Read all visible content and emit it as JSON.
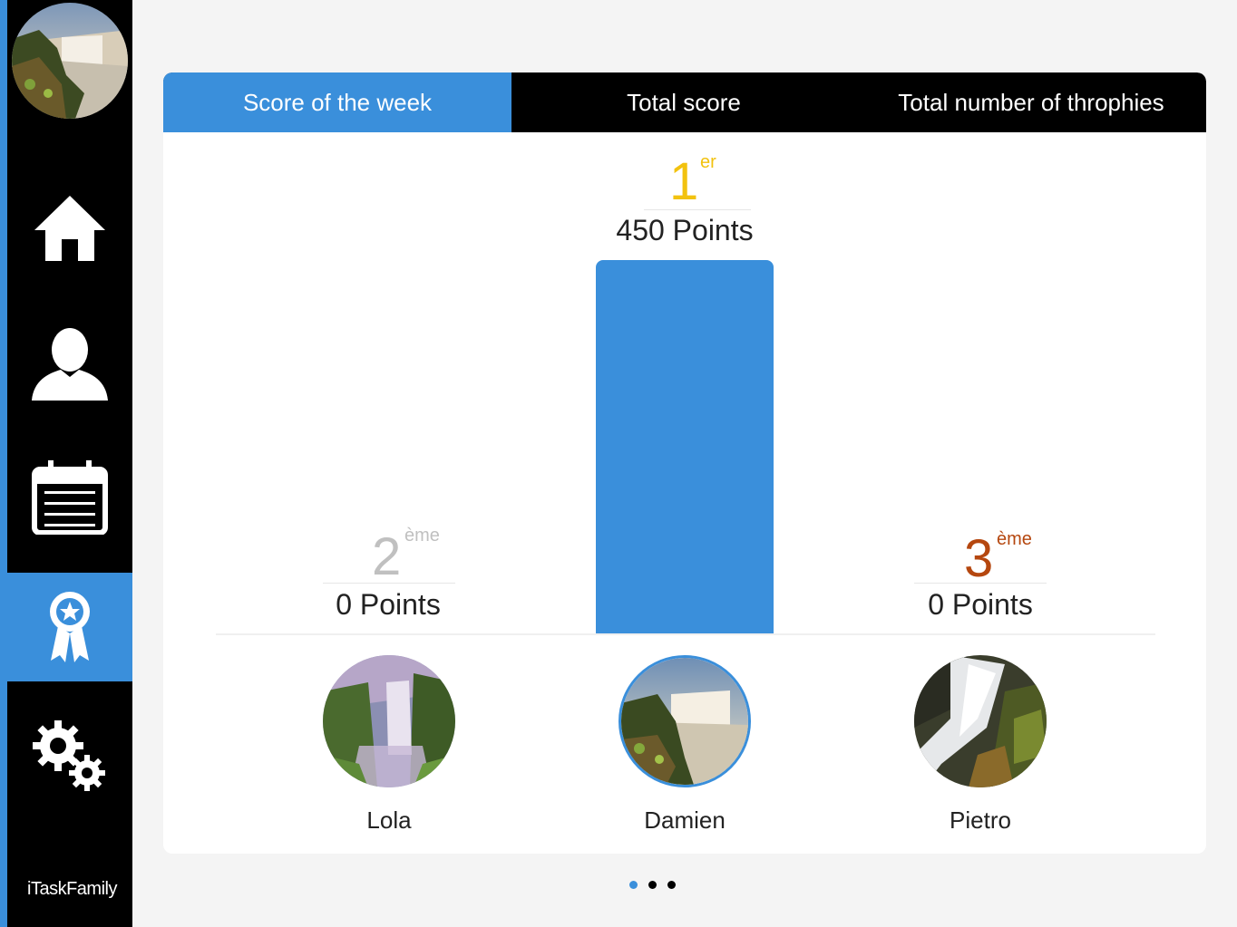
{
  "sidebar": {
    "brand_prefix": "i",
    "brand_task": "Task",
    "brand_family": "Family",
    "items": [
      {
        "name": "home",
        "icon": "home-icon",
        "active": false
      },
      {
        "name": "profile",
        "icon": "person-icon",
        "active": false
      },
      {
        "name": "calendar",
        "icon": "calendar-icon",
        "active": false
      },
      {
        "name": "awards",
        "icon": "award-ribbon-icon",
        "active": true
      },
      {
        "name": "settings",
        "icon": "gears-icon",
        "active": false
      }
    ]
  },
  "tabs": [
    {
      "label": "Score of the week",
      "active": true
    },
    {
      "label": "Total score",
      "active": false
    },
    {
      "label": "Total number of throphies",
      "active": false
    }
  ],
  "leaderboard": {
    "players": [
      {
        "name": "Lola",
        "rank": "2",
        "suffix": "ème",
        "points": "0 Points",
        "score": 0,
        "rank_color": "#c0c0c0"
      },
      {
        "name": "Damien",
        "rank": "1",
        "suffix": "er",
        "points": "450 Points",
        "score": 450,
        "rank_color": "#f2c20f",
        "selected": true
      },
      {
        "name": "Pietro",
        "rank": "3",
        "suffix": "ème",
        "points": "0 Points",
        "score": 0,
        "rank_color": "#b5470f"
      }
    ]
  },
  "pagination": {
    "pages": 3,
    "current": 1
  },
  "colors": {
    "accent": "#3a8fdb",
    "sidebar": "#000000"
  }
}
